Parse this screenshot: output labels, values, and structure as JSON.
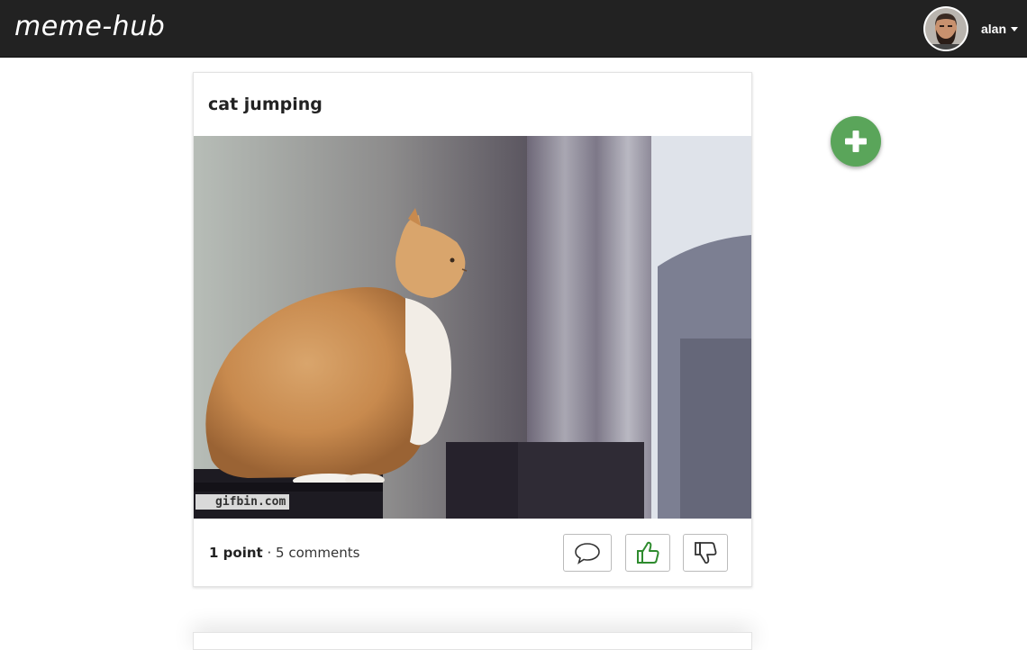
{
  "app": {
    "brand": "meme-hub",
    "user": {
      "name": "alan"
    }
  },
  "post": {
    "title": "cat jumping",
    "watermark": "gifbin.com",
    "points": "1 point",
    "separator": " · ",
    "comments": "5 comments"
  },
  "icons": {
    "comment": "speech-bubble-icon",
    "upvote": "thumbs-up-icon",
    "downvote": "thumbs-down-icon",
    "create": "plus-icon"
  },
  "colors": {
    "navbar": "#222222",
    "upvote_active": "#2e8b2e",
    "fab": "#5aa55a"
  }
}
